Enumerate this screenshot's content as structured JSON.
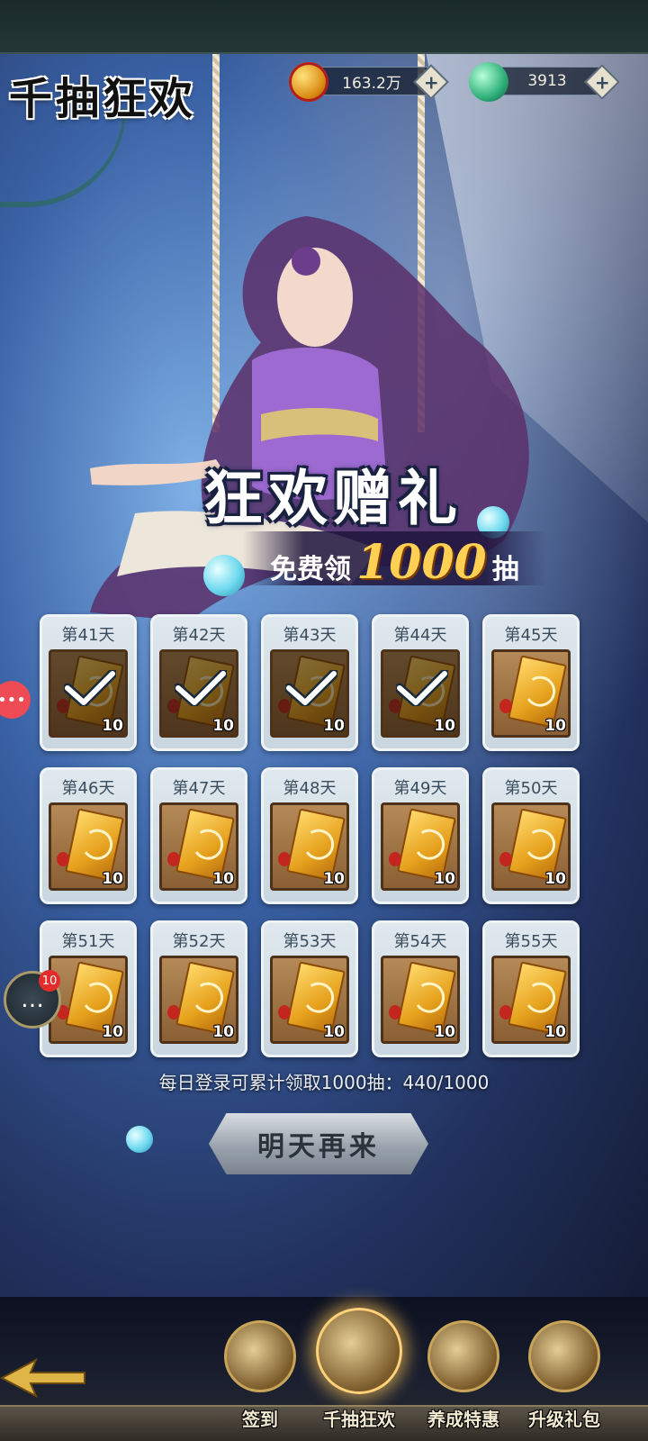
{
  "header": {
    "title": "千抽狂欢"
  },
  "currencies": [
    {
      "icon": "gold-coin-icon",
      "value": "163.2万"
    },
    {
      "icon": "jade-icon",
      "value": "3913"
    }
  ],
  "promo": {
    "title": "狂欢赠礼",
    "subtitle_prefix": "免费领",
    "subtitle_amount": "1000",
    "subtitle_suffix": "抽"
  },
  "rewards": [
    {
      "day": "第41天",
      "qty": "10",
      "claimed": true
    },
    {
      "day": "第42天",
      "qty": "10",
      "claimed": true
    },
    {
      "day": "第43天",
      "qty": "10",
      "claimed": true
    },
    {
      "day": "第44天",
      "qty": "10",
      "claimed": true
    },
    {
      "day": "第45天",
      "qty": "10",
      "claimed": false
    },
    {
      "day": "第46天",
      "qty": "10",
      "claimed": false
    },
    {
      "day": "第47天",
      "qty": "10",
      "claimed": false
    },
    {
      "day": "第48天",
      "qty": "10",
      "claimed": false
    },
    {
      "day": "第49天",
      "qty": "10",
      "claimed": false
    },
    {
      "day": "第50天",
      "qty": "10",
      "claimed": false
    },
    {
      "day": "第51天",
      "qty": "10",
      "claimed": false
    },
    {
      "day": "第52天",
      "qty": "10",
      "claimed": false
    },
    {
      "day": "第53天",
      "qty": "10",
      "claimed": false
    },
    {
      "day": "第54天",
      "qty": "10",
      "claimed": false
    },
    {
      "day": "第55天",
      "qty": "10",
      "claimed": false
    }
  ],
  "progress": {
    "text": "每日登录可累计领取1000抽：440/1000"
  },
  "main_button": {
    "label": "明天再来"
  },
  "chat": {
    "badge": "10"
  },
  "nav": [
    {
      "label": "签到",
      "icon": "sign-in-icon",
      "active": false
    },
    {
      "label": "千抽狂欢",
      "icon": "gift-box-icon",
      "active": true
    },
    {
      "label": "养成特惠",
      "icon": "treasure-chest-icon",
      "active": false
    },
    {
      "label": "升级礼包",
      "icon": "jade-pot-icon",
      "active": false
    }
  ],
  "colors": {
    "accent_gold": "#ffd054",
    "card_bg": "#dfe8ee",
    "badge_red": "#e32d2d"
  }
}
